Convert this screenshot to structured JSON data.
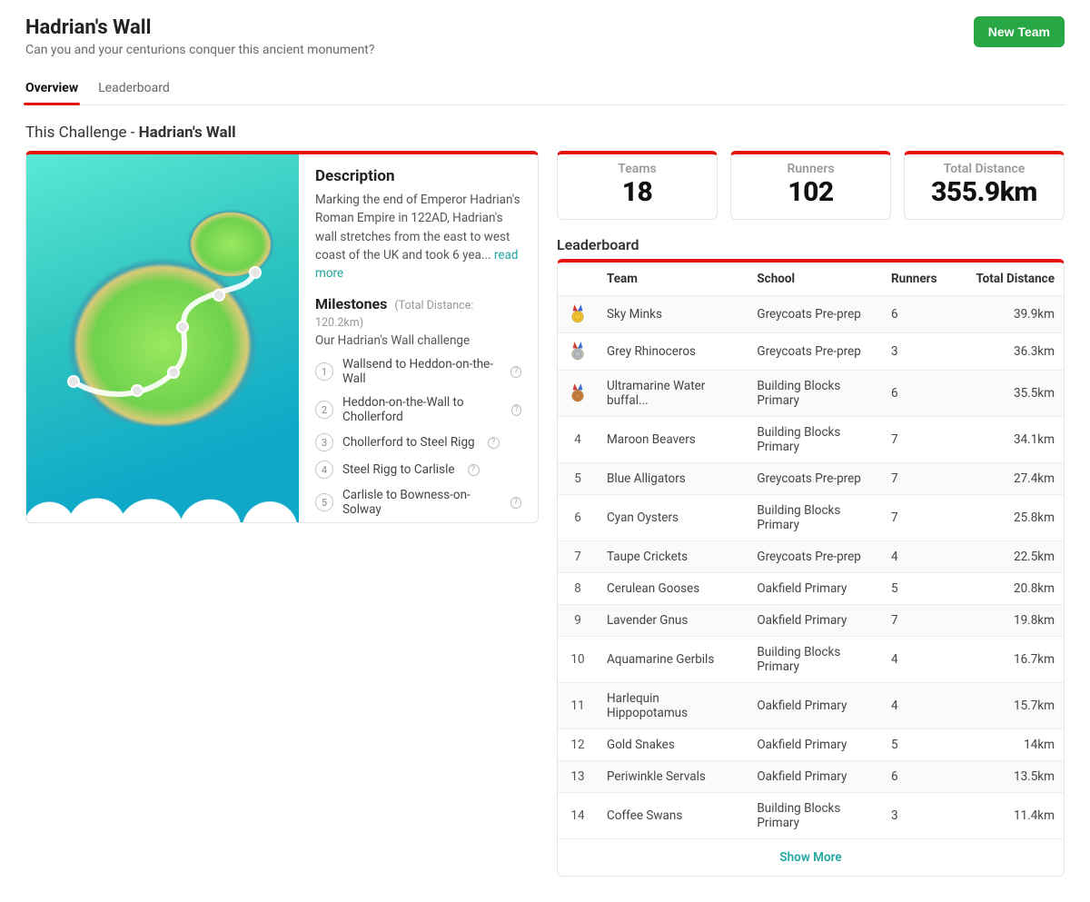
{
  "header": {
    "title": "Hadrian's Wall",
    "subtitle": "Can you and your centurions conquer this ancient monument?",
    "new_team_label": "New Team"
  },
  "tabs": [
    {
      "label": "Overview",
      "active": true
    },
    {
      "label": "Leaderboard",
      "active": false
    }
  ],
  "this_challenge": {
    "prefix": "This Challenge - ",
    "name": "Hadrian's Wall"
  },
  "description": {
    "heading": "Description",
    "text": "Marking the end of Emperor Hadrian's Roman Empire in 122AD, Hadrian's wall stretches from the east to west coast of the UK and took 6 yea... ",
    "read_more": "read more"
  },
  "milestones": {
    "heading": "Milestones",
    "total_label": "(Total Distance: 120.2km)",
    "subtitle": "Our Hadrian's Wall challenge",
    "items": [
      "Wallsend to Heddon-on-the-Wall",
      "Heddon-on-the-Wall to Chollerford",
      "Chollerford to Steel Rigg",
      "Steel Rigg to Carlisle",
      "Carlisle to Bowness-on-Solway"
    ]
  },
  "stats": {
    "teams": {
      "label": "Teams",
      "value": "18"
    },
    "runners": {
      "label": "Runners",
      "value": "102"
    },
    "distance": {
      "label": "Total Distance",
      "value": "355.9km"
    }
  },
  "leaderboard": {
    "heading": "Leaderboard",
    "columns": {
      "team": "Team",
      "school": "School",
      "runners": "Runners",
      "distance": "Total Distance"
    },
    "show_more": "Show More",
    "rows": [
      {
        "rank": 1,
        "medal": "gold",
        "team": "Sky Minks",
        "school": "Greycoats Pre-prep",
        "runners": "6",
        "distance": "39.9km"
      },
      {
        "rank": 2,
        "medal": "silver",
        "team": "Grey Rhinoceros",
        "school": "Greycoats Pre-prep",
        "runners": "3",
        "distance": "36.3km"
      },
      {
        "rank": 3,
        "medal": "bronze",
        "team": "Ultramarine Water buffal...",
        "school": "Building Blocks Primary",
        "runners": "6",
        "distance": "35.5km"
      },
      {
        "rank": 4,
        "team": "Maroon Beavers",
        "school": "Building Blocks Primary",
        "runners": "7",
        "distance": "34.1km"
      },
      {
        "rank": 5,
        "team": "Blue Alligators",
        "school": "Greycoats Pre-prep",
        "runners": "7",
        "distance": "27.4km"
      },
      {
        "rank": 6,
        "team": "Cyan Oysters",
        "school": "Building Blocks Primary",
        "runners": "7",
        "distance": "25.8km"
      },
      {
        "rank": 7,
        "team": "Taupe Crickets",
        "school": "Greycoats Pre-prep",
        "runners": "4",
        "distance": "22.5km"
      },
      {
        "rank": 8,
        "team": "Cerulean Gooses",
        "school": "Oakfield Primary",
        "runners": "5",
        "distance": "20.8km"
      },
      {
        "rank": 9,
        "team": "Lavender Gnus",
        "school": "Oakfield Primary",
        "runners": "7",
        "distance": "19.8km"
      },
      {
        "rank": 10,
        "team": "Aquamarine Gerbils",
        "school": "Building Blocks Primary",
        "runners": "4",
        "distance": "16.7km"
      },
      {
        "rank": 11,
        "team": "Harlequin Hippopotamus",
        "school": "Oakfield Primary",
        "runners": "4",
        "distance": "15.7km"
      },
      {
        "rank": 12,
        "team": "Gold Snakes",
        "school": "Oakfield Primary",
        "runners": "5",
        "distance": "14km"
      },
      {
        "rank": 13,
        "team": "Periwinkle Servals",
        "school": "Oakfield Primary",
        "runners": "6",
        "distance": "13.5km"
      },
      {
        "rank": 14,
        "team": "Coffee Swans",
        "school": "Building Blocks Primary",
        "runners": "3",
        "distance": "11.4km"
      }
    ]
  },
  "colors": {
    "brand_red": "#e4140f",
    "brand_green": "#28a745",
    "brand_teal": "#1fa8a0",
    "medal_gold": "#f4c430",
    "medal_silver": "#b8bcc2",
    "medal_bronze": "#c87f3d"
  }
}
